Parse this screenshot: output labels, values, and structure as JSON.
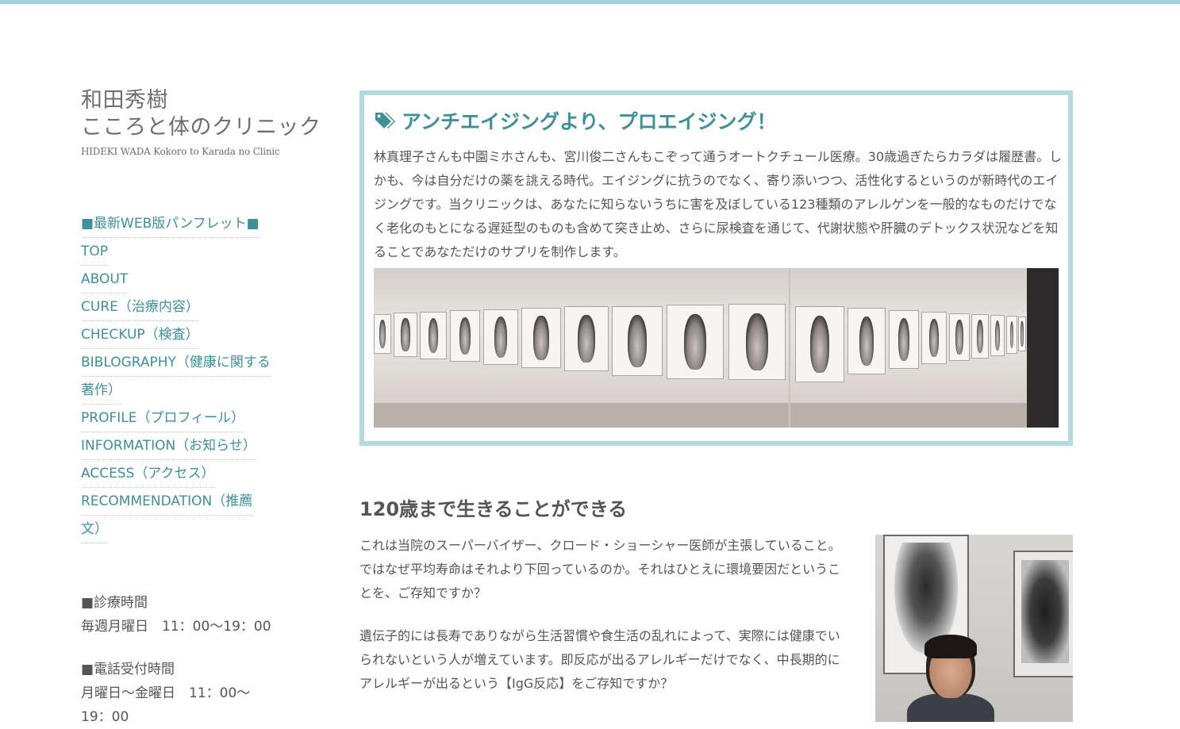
{
  "site": {
    "logo_line1": "和田秀樹",
    "logo_line2": "こころと体のクリニック",
    "logo_en": "HIDEKI WADA Kokoro to Karada no Clinic"
  },
  "nav": {
    "items": [
      {
        "label": "■最新WEB版パンフレット■"
      },
      {
        "label": "TOP"
      },
      {
        "label": "ABOUT"
      },
      {
        "label": "CURE（治療内容）"
      },
      {
        "label": "CHECKUP（検査）"
      },
      {
        "label": "BIBLOGRAPHY（健康に関する"
      },
      {
        "label": "著作）"
      },
      {
        "label": "PROFILE（プロフィール）"
      },
      {
        "label": "INFORMATION（お知らせ）"
      },
      {
        "label": "ACCESS（アクセス）"
      },
      {
        "label": "RECOMMENDATION（推薦"
      },
      {
        "label": "文）"
      }
    ]
  },
  "info": {
    "hours_heading": "■診療時間",
    "hours_value": "毎週月曜日　11：00〜19：00",
    "phone_heading": "■電話受付時間",
    "phone_value_1": "月曜日〜金曜日　11：00〜",
    "phone_value_2": "19：00"
  },
  "feature": {
    "icon": "tags-icon",
    "title": "アンチエイジングより、プロエイジング！",
    "body": "林真理子さんも中園ミホさんも、宮川俊二さんもこぞって通うオートクチュール医療。30歳過ぎたらカラダは履歴書。しかも、今は自分だけの薬を誂える時代。エイジングに抗うのでなく、寄り添いつつ、活性化するというのが新時代のエイジングです。当クリニックは、あなたに知らないうちに害を及ぼしている123種類のアレルゲンを一般的なものだけでなく老化のもとになる遅延型のものも含めて突き止め、さらに尿検査を通じて、代謝状態や肝臓のデトックス状況などを知ることであなただけのサプリを制作します。"
  },
  "section": {
    "title": "120歳まで生きることができる",
    "para1": "これは当院のスーパーバイザー、クロード・ショーシャー医師が主張していること。ではなぜ平均寿命はそれより下回っているのか。それはひとえに環境要因だということを、ご存知ですか？",
    "para2": "遺伝子的には長寿でありながら生活習慣や食生活の乱れによって、実際には健康でいられないという人が増えています。即反応が出るアレルギーだけでなく、中長期的にアレルギーが出るという【IgG反応】をご存知ですか？"
  },
  "colors": {
    "accent": "#3e9197",
    "topbar": "#a3d4d9",
    "feature_border": "#b3dadd",
    "text": "#555555"
  }
}
